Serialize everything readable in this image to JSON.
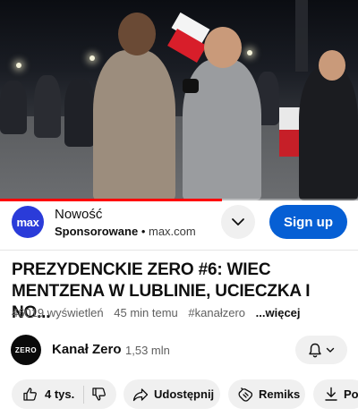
{
  "video": {
    "progress_fraction": 0.62
  },
  "ad": {
    "brand_logo_text": "max",
    "headline": "Nowość",
    "sponsored_label": "Sponsorowane",
    "separator": "•",
    "domain": "max.com",
    "cta_label": "Sign up"
  },
  "video_info": {
    "title": "PREZYDENCKIE ZERO #6: WIEC MENTZENA W LUBLINIE, UCIECZKA I NO...",
    "views": "46019 wyświetleń",
    "age": "45 min temu",
    "hashtag": "#kanałzero",
    "more_label": "...więcej"
  },
  "channel": {
    "logo_text": "ZERO",
    "name": "Kanał Zero",
    "subscribers": "1,53 mln"
  },
  "actions": {
    "likes": "4 tys.",
    "share": "Udostępnij",
    "remix": "Remiks",
    "download": "Po"
  },
  "colors": {
    "signup_blue": "#065fd4",
    "max_brand": "#2a3bd9",
    "progress_red": "#ff0000"
  }
}
